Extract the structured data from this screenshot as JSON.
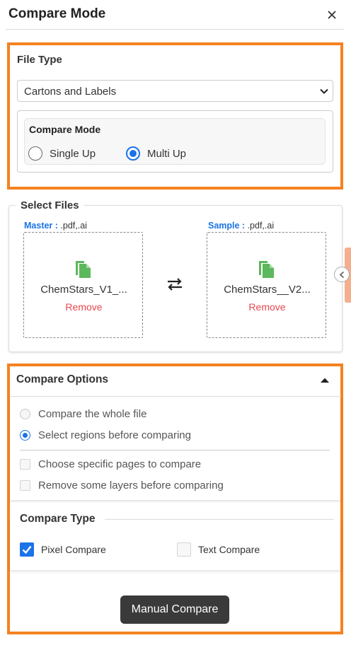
{
  "header": {
    "title": "Compare Mode",
    "close_symbol": "✕"
  },
  "file_type": {
    "label": "File Type",
    "selected": "Cartons and Labels",
    "compare_mode": {
      "label": "Compare Mode",
      "options": [
        {
          "label": "Single Up",
          "checked": false
        },
        {
          "label": "Multi Up",
          "checked": true
        }
      ]
    }
  },
  "select_files": {
    "title": "Select Files",
    "master": {
      "label": "Master :",
      "types": " .pdf,.ai",
      "file_name": "ChemStars_V1_...",
      "remove": "Remove"
    },
    "sample": {
      "label": "Sample :",
      "types": " .pdf,.ai",
      "file_name": "ChemStars__V2...",
      "remove": "Remove"
    }
  },
  "compare_options": {
    "title": "Compare Options",
    "radios": [
      {
        "label": "Compare the whole file",
        "checked": false
      },
      {
        "label": "Select regions before comparing",
        "checked": true
      }
    ],
    "checkboxes": [
      {
        "label": "Choose specific pages to compare",
        "checked": false
      },
      {
        "label": "Remove some layers before comparing",
        "checked": false
      }
    ]
  },
  "compare_type": {
    "title": "Compare Type",
    "options": [
      {
        "label": "Pixel Compare",
        "checked": true
      },
      {
        "label": "Text Compare",
        "checked": false
      }
    ]
  },
  "actions": {
    "manual_compare": "Manual Compare"
  },
  "colors": {
    "highlight": "#f58220",
    "accent": "#1a73e8",
    "remove": "#e8484d",
    "file_icon": "#5cb85c"
  }
}
